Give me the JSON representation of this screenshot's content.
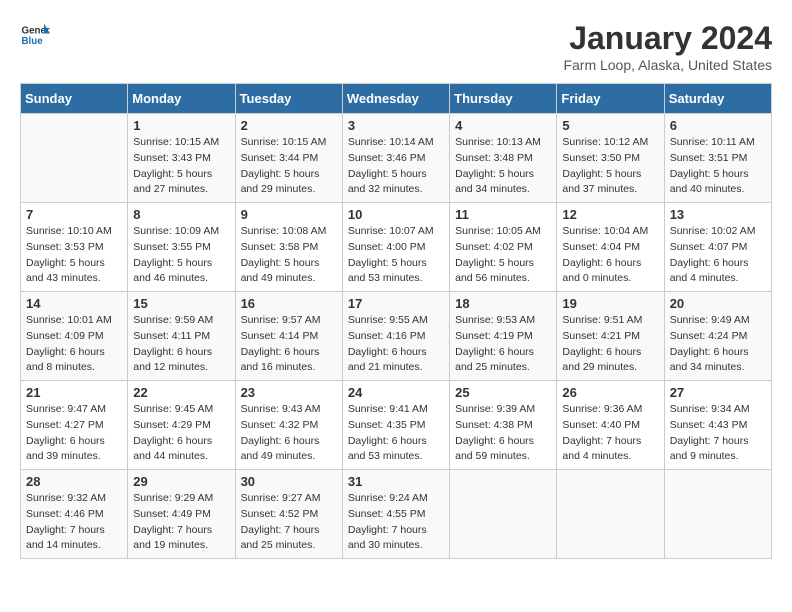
{
  "header": {
    "logo_general": "General",
    "logo_blue": "Blue",
    "month": "January 2024",
    "location": "Farm Loop, Alaska, United States"
  },
  "weekdays": [
    "Sunday",
    "Monday",
    "Tuesday",
    "Wednesday",
    "Thursday",
    "Friday",
    "Saturday"
  ],
  "weeks": [
    [
      {
        "day": "",
        "info": ""
      },
      {
        "day": "1",
        "info": "Sunrise: 10:15 AM\nSunset: 3:43 PM\nDaylight: 5 hours\nand 27 minutes."
      },
      {
        "day": "2",
        "info": "Sunrise: 10:15 AM\nSunset: 3:44 PM\nDaylight: 5 hours\nand 29 minutes."
      },
      {
        "day": "3",
        "info": "Sunrise: 10:14 AM\nSunset: 3:46 PM\nDaylight: 5 hours\nand 32 minutes."
      },
      {
        "day": "4",
        "info": "Sunrise: 10:13 AM\nSunset: 3:48 PM\nDaylight: 5 hours\nand 34 minutes."
      },
      {
        "day": "5",
        "info": "Sunrise: 10:12 AM\nSunset: 3:50 PM\nDaylight: 5 hours\nand 37 minutes."
      },
      {
        "day": "6",
        "info": "Sunrise: 10:11 AM\nSunset: 3:51 PM\nDaylight: 5 hours\nand 40 minutes."
      }
    ],
    [
      {
        "day": "7",
        "info": "Sunrise: 10:10 AM\nSunset: 3:53 PM\nDaylight: 5 hours\nand 43 minutes."
      },
      {
        "day": "8",
        "info": "Sunrise: 10:09 AM\nSunset: 3:55 PM\nDaylight: 5 hours\nand 46 minutes."
      },
      {
        "day": "9",
        "info": "Sunrise: 10:08 AM\nSunset: 3:58 PM\nDaylight: 5 hours\nand 49 minutes."
      },
      {
        "day": "10",
        "info": "Sunrise: 10:07 AM\nSunset: 4:00 PM\nDaylight: 5 hours\nand 53 minutes."
      },
      {
        "day": "11",
        "info": "Sunrise: 10:05 AM\nSunset: 4:02 PM\nDaylight: 5 hours\nand 56 minutes."
      },
      {
        "day": "12",
        "info": "Sunrise: 10:04 AM\nSunset: 4:04 PM\nDaylight: 6 hours\nand 0 minutes."
      },
      {
        "day": "13",
        "info": "Sunrise: 10:02 AM\nSunset: 4:07 PM\nDaylight: 6 hours\nand 4 minutes."
      }
    ],
    [
      {
        "day": "14",
        "info": "Sunrise: 10:01 AM\nSunset: 4:09 PM\nDaylight: 6 hours\nand 8 minutes."
      },
      {
        "day": "15",
        "info": "Sunrise: 9:59 AM\nSunset: 4:11 PM\nDaylight: 6 hours\nand 12 minutes."
      },
      {
        "day": "16",
        "info": "Sunrise: 9:57 AM\nSunset: 4:14 PM\nDaylight: 6 hours\nand 16 minutes."
      },
      {
        "day": "17",
        "info": "Sunrise: 9:55 AM\nSunset: 4:16 PM\nDaylight: 6 hours\nand 21 minutes."
      },
      {
        "day": "18",
        "info": "Sunrise: 9:53 AM\nSunset: 4:19 PM\nDaylight: 6 hours\nand 25 minutes."
      },
      {
        "day": "19",
        "info": "Sunrise: 9:51 AM\nSunset: 4:21 PM\nDaylight: 6 hours\nand 29 minutes."
      },
      {
        "day": "20",
        "info": "Sunrise: 9:49 AM\nSunset: 4:24 PM\nDaylight: 6 hours\nand 34 minutes."
      }
    ],
    [
      {
        "day": "21",
        "info": "Sunrise: 9:47 AM\nSunset: 4:27 PM\nDaylight: 6 hours\nand 39 minutes."
      },
      {
        "day": "22",
        "info": "Sunrise: 9:45 AM\nSunset: 4:29 PM\nDaylight: 6 hours\nand 44 minutes."
      },
      {
        "day": "23",
        "info": "Sunrise: 9:43 AM\nSunset: 4:32 PM\nDaylight: 6 hours\nand 49 minutes."
      },
      {
        "day": "24",
        "info": "Sunrise: 9:41 AM\nSunset: 4:35 PM\nDaylight: 6 hours\nand 53 minutes."
      },
      {
        "day": "25",
        "info": "Sunrise: 9:39 AM\nSunset: 4:38 PM\nDaylight: 6 hours\nand 59 minutes."
      },
      {
        "day": "26",
        "info": "Sunrise: 9:36 AM\nSunset: 4:40 PM\nDaylight: 7 hours\nand 4 minutes."
      },
      {
        "day": "27",
        "info": "Sunrise: 9:34 AM\nSunset: 4:43 PM\nDaylight: 7 hours\nand 9 minutes."
      }
    ],
    [
      {
        "day": "28",
        "info": "Sunrise: 9:32 AM\nSunset: 4:46 PM\nDaylight: 7 hours\nand 14 minutes."
      },
      {
        "day": "29",
        "info": "Sunrise: 9:29 AM\nSunset: 4:49 PM\nDaylight: 7 hours\nand 19 minutes."
      },
      {
        "day": "30",
        "info": "Sunrise: 9:27 AM\nSunset: 4:52 PM\nDaylight: 7 hours\nand 25 minutes."
      },
      {
        "day": "31",
        "info": "Sunrise: 9:24 AM\nSunset: 4:55 PM\nDaylight: 7 hours\nand 30 minutes."
      },
      {
        "day": "",
        "info": ""
      },
      {
        "day": "",
        "info": ""
      },
      {
        "day": "",
        "info": ""
      }
    ]
  ]
}
